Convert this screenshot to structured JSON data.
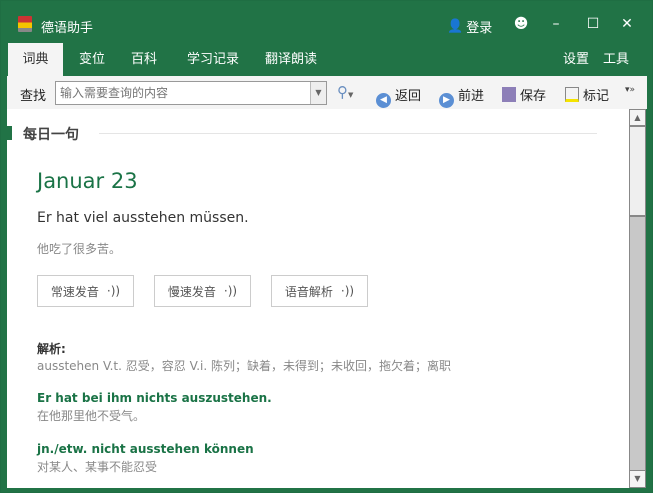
{
  "app": {
    "title": "德语助手",
    "login": "登录"
  },
  "tabs": [
    "词典",
    "变位",
    "百科",
    "学习记录",
    "翻译朗读"
  ],
  "right_tabs": {
    "settings": "设置",
    "tools": "工具"
  },
  "toolbar": {
    "search_label": "查找",
    "search_placeholder": "输入需要查询的内容",
    "back": "返回",
    "forward": "前进",
    "save": "保存",
    "mark": "标记"
  },
  "daily": {
    "section_title": "每日一句",
    "date": "Januar 23",
    "sentence": "Er hat viel ausstehen müssen.",
    "translation": "他吃了很多苦。",
    "buttons": [
      "常速发音",
      "慢速发音",
      "语音解析"
    ],
    "analysis_label": "解析:",
    "analysis": "ausstehen V.t. 忍受，容忍 V.i. 陈列；缺着，未得到；未收回，拖欠着；离职",
    "examples": [
      {
        "de": "Er hat bei ihm nichts auszustehen.",
        "zh": "在他那里他不受气。"
      },
      {
        "de": "jn./etw. nicht ausstehen können",
        "zh": "对某人、某事不能忍受"
      }
    ]
  }
}
